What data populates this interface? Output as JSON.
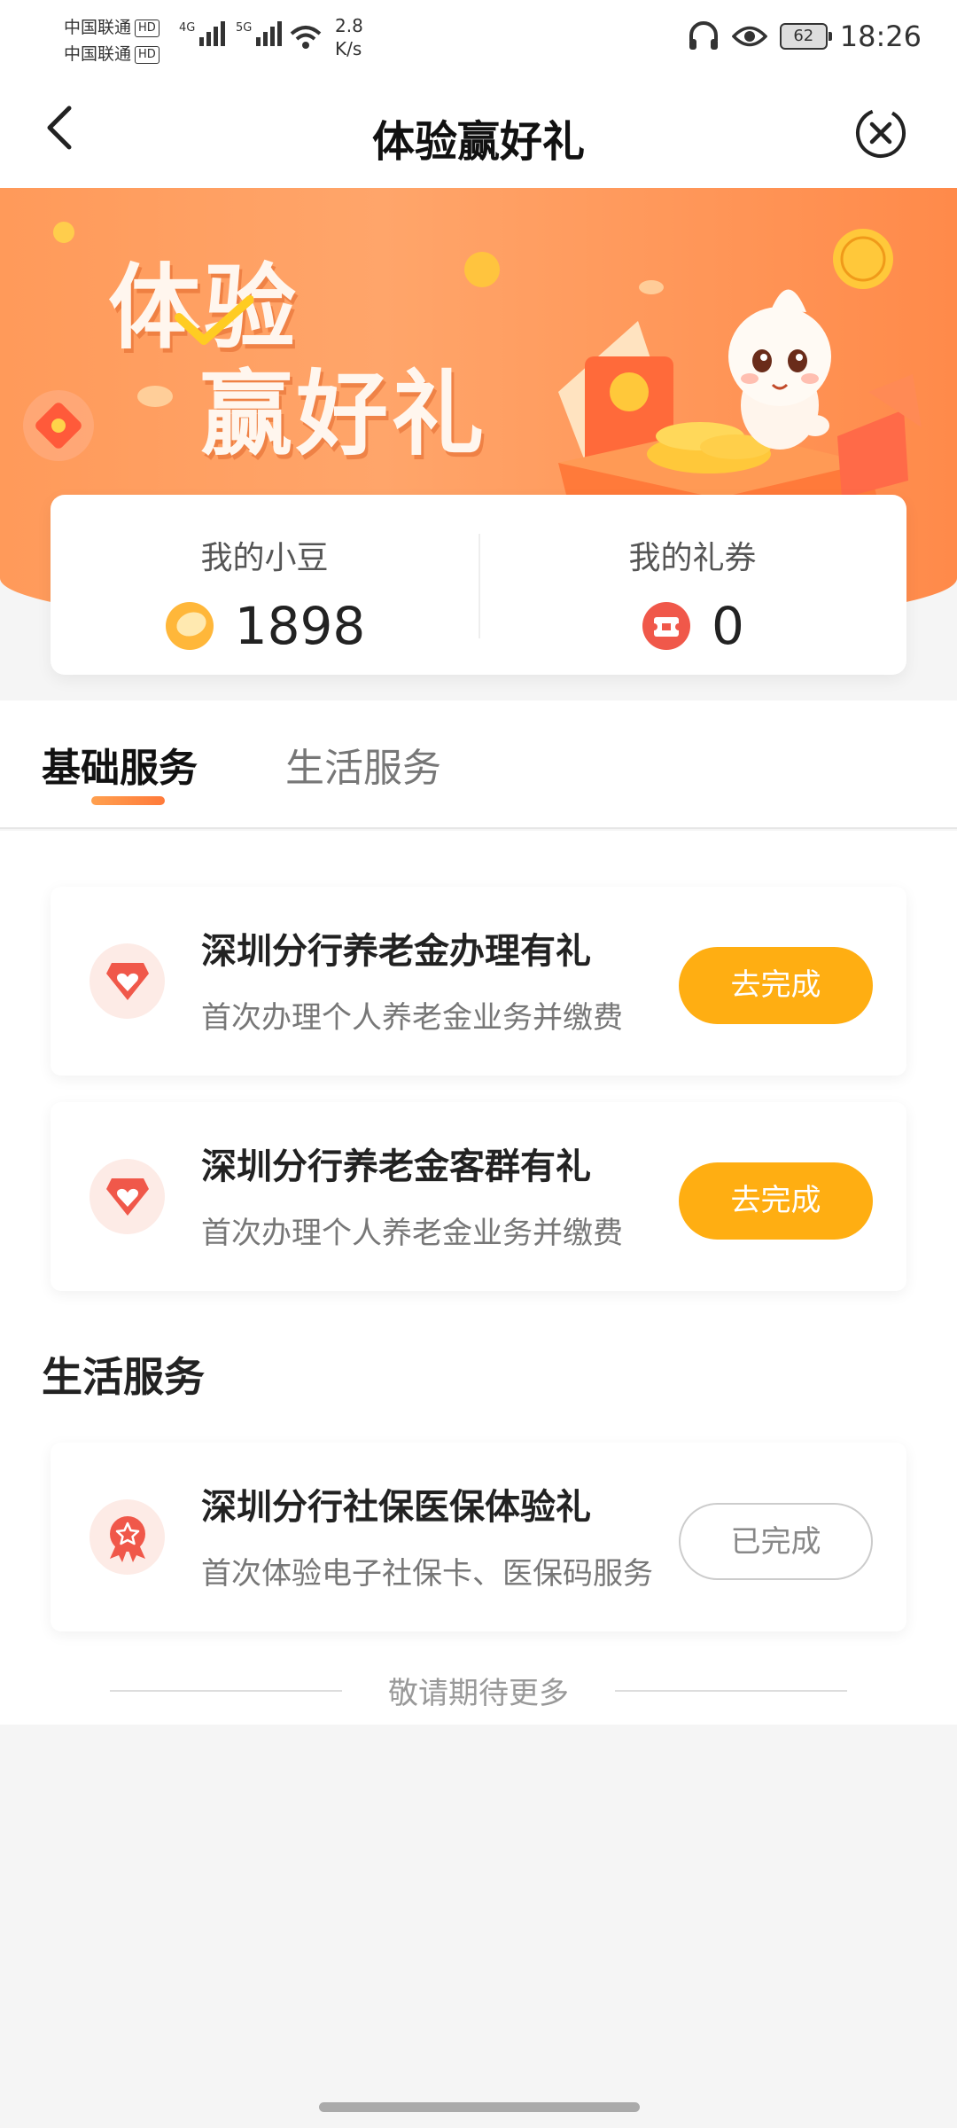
{
  "status_bar": {
    "carrier1": "中国联通",
    "carrier2": "中国联通",
    "hd": "HD",
    "net1": "4G",
    "net2": "5G",
    "speed_value": "2.8",
    "speed_unit": "K/s",
    "battery": "62",
    "time": "18:26"
  },
  "nav": {
    "title": "体验赢好礼"
  },
  "banner": {
    "line1": "体验",
    "line2": "赢好礼"
  },
  "stats": {
    "beans_label": "我的小豆",
    "beans_value": "1898",
    "coupons_label": "我的礼券",
    "coupons_value": "0"
  },
  "tabs": [
    {
      "label": "基础服务",
      "active": true
    },
    {
      "label": "生活服务",
      "active": false
    }
  ],
  "basic_tasks": [
    {
      "title": "深圳分行养老金办理有礼",
      "desc": "首次办理个人养老金业务并缴费",
      "button": "去完成"
    },
    {
      "title": "深圳分行养老金客群有礼",
      "desc": "首次办理个人养老金业务并缴费",
      "button": "去完成"
    }
  ],
  "life_section_title": "生活服务",
  "life_tasks": [
    {
      "title": "深圳分行社保医保体验礼",
      "desc": "首次体验电子社保卡、医保码服务",
      "button": "已完成"
    }
  ],
  "footer_note": "敬请期待更多",
  "colors": {
    "accent": "#ffae12",
    "banner": "#ff9a5a",
    "tab_indicator": "#ff8a44",
    "icon_red": "#f0584a"
  }
}
